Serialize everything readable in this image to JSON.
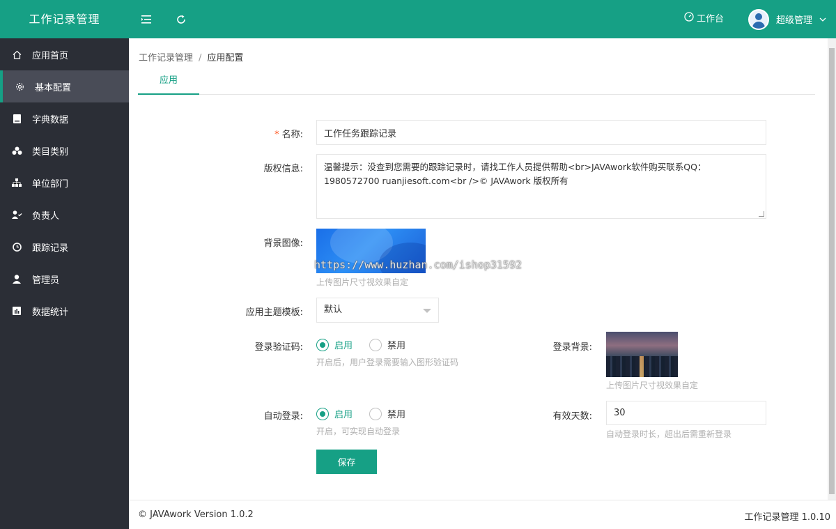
{
  "header": {
    "brand": "工作记录管理",
    "workbench": "工作台",
    "user": "超级管理"
  },
  "sidebar": {
    "items": [
      {
        "label": "应用首页",
        "icon": "home-icon"
      },
      {
        "label": "基本配置",
        "icon": "gear-icon"
      },
      {
        "label": "字典数据",
        "icon": "book-icon"
      },
      {
        "label": "类目类别",
        "icon": "cubes-icon"
      },
      {
        "label": "单位部门",
        "icon": "sitemap-icon"
      },
      {
        "label": "负责人",
        "icon": "user-check-icon"
      },
      {
        "label": "跟踪记录",
        "icon": "clock-icon"
      },
      {
        "label": "管理员",
        "icon": "user-icon"
      },
      {
        "label": "数据统计",
        "icon": "bar-chart-icon"
      }
    ]
  },
  "breadcrumb": {
    "root": "工作记录管理",
    "separator": "/",
    "current": "应用配置"
  },
  "tabs": [
    "应用"
  ],
  "form": {
    "name": {
      "label": "名称:",
      "required_mark": "*",
      "value": "工作任务跟踪记录"
    },
    "copyright": {
      "label": "版权信息:",
      "value": "温馨提示：没查到您需要的跟踪记录时，请找工作人员提供帮助<br>JAVAwork软件购买联系QQ：1980572700 ruanjiesoft.com<br />© JAVAwork 版权所有"
    },
    "background": {
      "label": "背景图像:",
      "help": "上传图片尺寸视效果自定",
      "watermark": "https://www.huzhan.com/ishop31592"
    },
    "theme": {
      "label": "应用主题模板:",
      "value": "默认"
    },
    "captcha": {
      "label": "登录验证码:",
      "on": "启用",
      "off": "禁用",
      "selected": "启用",
      "help": "开启后，用户登录需要输入图形验证码"
    },
    "login_bg": {
      "label": "登录背景:",
      "help": "上传图片尺寸视效果自定"
    },
    "auto_login": {
      "label": "自动登录:",
      "on": "启用",
      "off": "禁用",
      "selected": "启用",
      "help": "开启，可实现自动登录"
    },
    "valid_days": {
      "label": "有效天数:",
      "value": "30",
      "help": "自动登录时长，超出后需重新登录"
    },
    "save": "保存"
  },
  "footer": {
    "left": "© JAVAwork Version 1.0.2",
    "right": "工作记录管理 1.0.10"
  },
  "colors": {
    "accent": "#16a085",
    "sidebar_bg": "#2b2e36",
    "sidebar_active": "#494c57"
  }
}
